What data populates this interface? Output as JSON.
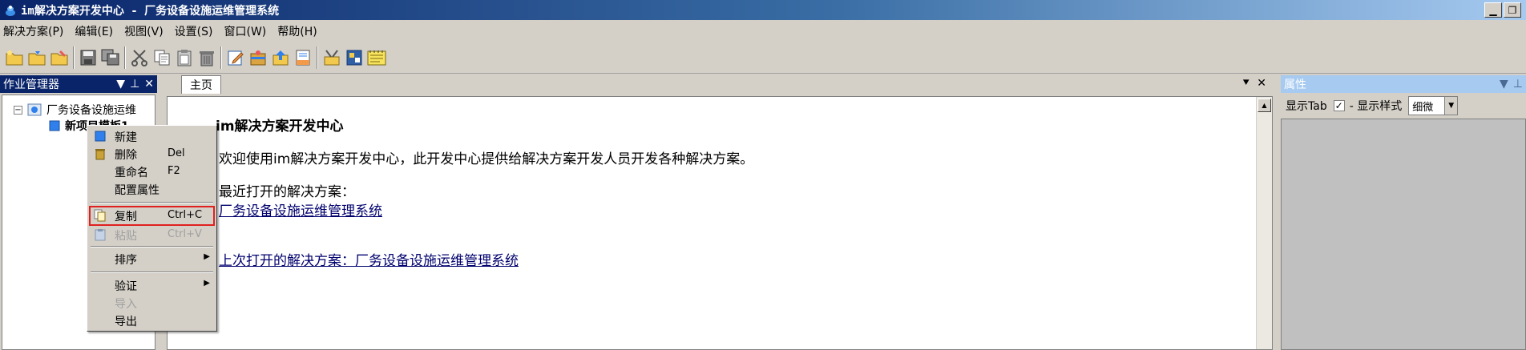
{
  "window": {
    "title": "im解决方案开发中心 - 厂务设备设施运维管理系统"
  },
  "menubar": {
    "items": [
      "解决方案(P)",
      "编辑(E)",
      "视图(V)",
      "设置(S)",
      "窗口(W)",
      "帮助(H)"
    ]
  },
  "left_panel": {
    "title": "作业管理器",
    "tree": {
      "root_label": "厂务设备设施运维",
      "child_label": "新项目模板1"
    }
  },
  "document": {
    "tab_label": "主页",
    "heading": "im解决方案开发中心",
    "description": "欢迎使用im解决方案开发中心，此开发中心提供给解决方案开发人员开发各种解决方案。",
    "recent_label": "最近打开的解决方案：",
    "recent_link": "厂务设备设施运维管理系统",
    "last_link": "上次打开的解决方案：厂务设备设施运维管理系统"
  },
  "properties_panel": {
    "title": "属性",
    "show_tab_label": "显示Tab",
    "show_tab_checked": true,
    "style_label": "- 显示样式",
    "style_value": "细微"
  },
  "context_menu": {
    "new_label": "新建",
    "delete_label": "删除",
    "delete_shortcut": "Del",
    "rename_label": "重命名",
    "rename_shortcut": "F2",
    "config_label": "配置属性",
    "copy_label": "复制",
    "copy_shortcut": "Ctrl+C",
    "paste_label": "粘贴",
    "paste_shortcut": "Ctrl+V",
    "sort_label": "排序",
    "validate_label": "验证",
    "import_label": "导入",
    "export_label": "导出"
  },
  "colors": {
    "title_active": "#0a246a",
    "highlight_box": "#e02020",
    "link": "#00006e"
  }
}
